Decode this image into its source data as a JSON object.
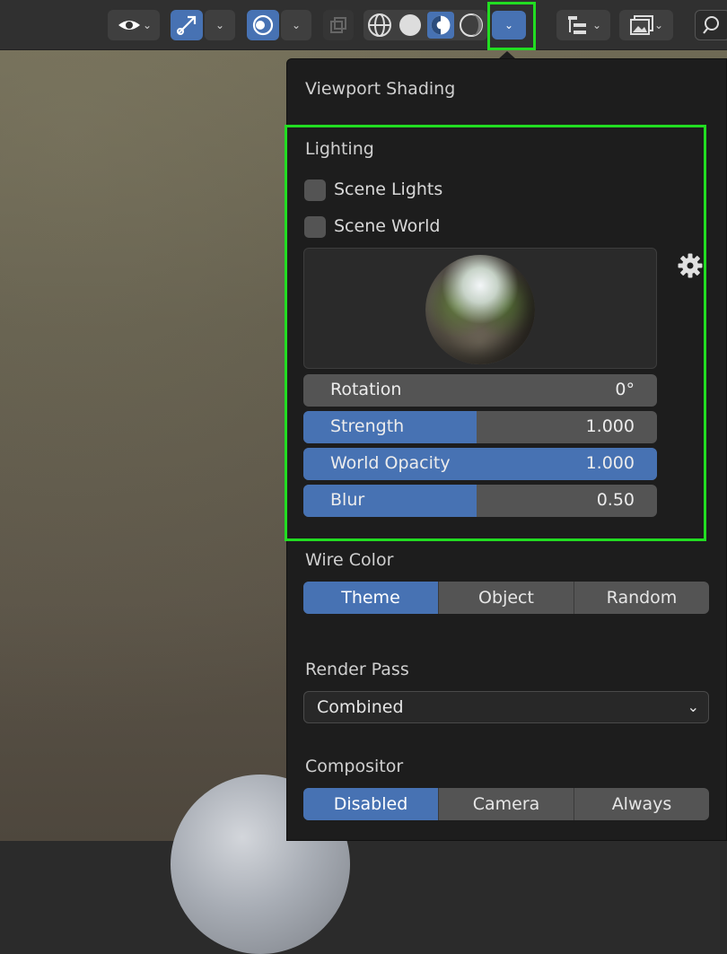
{
  "panel": {
    "title": "Viewport Shading",
    "lighting": {
      "heading": "Lighting",
      "scene_lights_label": "Scene Lights",
      "scene_lights_checked": false,
      "scene_world_label": "Scene World",
      "scene_world_checked": false,
      "settings_icon": "gear-icon",
      "sliders": [
        {
          "label": "Rotation",
          "value": "0°",
          "fill": 0.0
        },
        {
          "label": "Strength",
          "value": "1.000",
          "fill": 0.49
        },
        {
          "label": "World Opacity",
          "value": "1.000",
          "fill": 1.0
        },
        {
          "label": "Blur",
          "value": "0.50",
          "fill": 0.49
        }
      ]
    },
    "wire_color": {
      "heading": "Wire Color",
      "options": [
        "Theme",
        "Object",
        "Random"
      ],
      "selected": "Theme"
    },
    "render_pass": {
      "heading": "Render Pass",
      "selected": "Combined"
    },
    "compositor": {
      "heading": "Compositor",
      "options": [
        "Disabled",
        "Camera",
        "Always"
      ],
      "selected": "Disabled"
    }
  },
  "header": {
    "icons": [
      "visibility-eye-icon",
      "gizmo-icon",
      "overlay-icon",
      "xray-icon",
      "wireframe-icon",
      "solid-icon",
      "material-preview-icon",
      "rendered-icon",
      "shading-options-chevron",
      "outliner-icon",
      "image-icon",
      "search-icon"
    ]
  },
  "colors": {
    "accent": "#4772b3",
    "highlight": "#22dd22",
    "panel_bg": "#1d1d1d"
  }
}
